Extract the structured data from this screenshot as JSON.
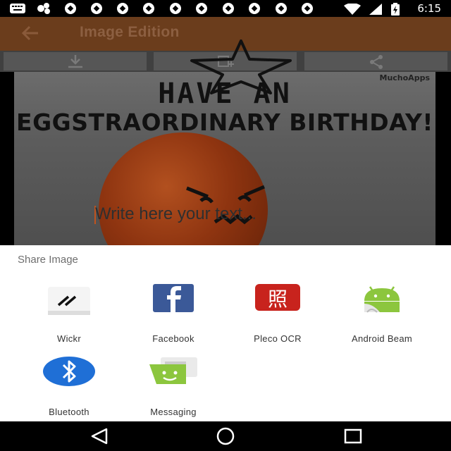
{
  "status_bar": {
    "time": "6:15",
    "notification_icons": [
      "keyboard-icon",
      "photos-icon",
      "soccer-icon",
      "soccer-icon",
      "soccer-icon",
      "soccer-icon",
      "soccer-icon",
      "soccer-icon",
      "soccer-icon",
      "soccer-icon",
      "soccer-icon",
      "soccer-icon"
    ]
  },
  "app_bar": {
    "title": "Image Edition"
  },
  "canvas": {
    "watermark": "MuchoApps",
    "headline_line1": "HAVE AN",
    "headline_line2": "EGGSTRAORDINARY BIRTHDAY!",
    "text_placeholder": "Write here your text..."
  },
  "share_sheet": {
    "title": "Share Image",
    "apps": [
      {
        "label": "Wickr",
        "icon": "wickr-icon"
      },
      {
        "label": "Facebook",
        "icon": "facebook-icon"
      },
      {
        "label": "Pleco OCR",
        "icon": "pleco-ocr-icon"
      },
      {
        "label": "Android Beam",
        "icon": "android-beam-icon"
      },
      {
        "label": "Bluetooth",
        "icon": "bluetooth-icon"
      },
      {
        "label": "Messaging",
        "icon": "messaging-icon"
      }
    ]
  },
  "colors": {
    "app_bar_dim": "#6b3d1c",
    "facebook_blue": "#3b5998",
    "pleco_red": "#c8231d",
    "android_green": "#8cc63e",
    "bluetooth_blue": "#1f6fd6",
    "messaging_green": "#8cc63e"
  }
}
